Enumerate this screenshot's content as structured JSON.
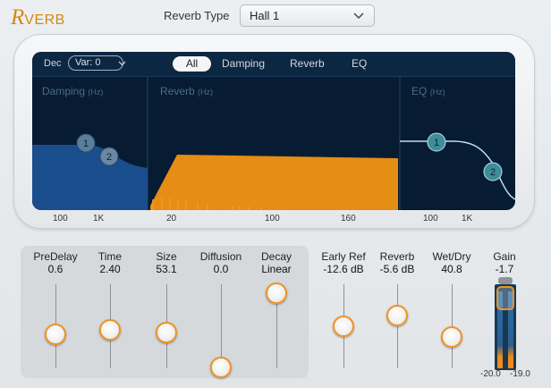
{
  "logo": {
    "cap": "R",
    "rest": "VERB"
  },
  "reverb_type": {
    "label": "Reverb Type",
    "value": "Hall 1"
  },
  "display": {
    "dec_label": "Dec",
    "var_value": "Var: 0",
    "tabs": [
      "All",
      "Damping",
      "Reverb",
      "EQ"
    ],
    "active_tab": "All",
    "sections": [
      {
        "title": "Damping",
        "unit": "(Hz)"
      },
      {
        "title": "Reverb",
        "unit": "(Hz)"
      },
      {
        "title": "EQ",
        "unit": "(Hz)"
      }
    ],
    "damping_nodes": [
      "1",
      "2"
    ],
    "eq_nodes": [
      "1",
      "2"
    ],
    "x_ticks": {
      "damping": [
        "100",
        "1K"
      ],
      "reverb": [
        "20",
        "100",
        "160"
      ],
      "eq": [
        "100",
        "1K"
      ]
    }
  },
  "params": [
    {
      "name": "PreDelay",
      "value": "0.6",
      "level": 0.44
    },
    {
      "name": "Time",
      "value": "2.40",
      "level": 0.51
    },
    {
      "name": "Size",
      "value": "53.1",
      "level": 0.47
    },
    {
      "name": "Diffusion",
      "value": "0.0",
      "level": 0.0
    },
    {
      "name": "Decay",
      "value": "Linear",
      "level": 1.0
    },
    {
      "name": "Early Ref",
      "value": "-12.6 dB",
      "level": 0.55
    },
    {
      "name": "Reverb",
      "value": "-5.6 dB",
      "level": 0.7
    },
    {
      "name": "Wet/Dry",
      "value": "40.8",
      "level": 0.41
    }
  ],
  "gain": {
    "name": "Gain",
    "value": "-1.7",
    "meter_left": "-20.0",
    "meter_right": "-19.0"
  },
  "colors": {
    "accent": "#ef9321",
    "display_bg": "#071c33",
    "reverb_fill": "#e58d15",
    "damping_fill": "#1a4d8c",
    "node": "#5a7f9e",
    "eq_node": "#3e8e9a"
  },
  "icons": {
    "select_chevron": "chevron-down-icon"
  }
}
